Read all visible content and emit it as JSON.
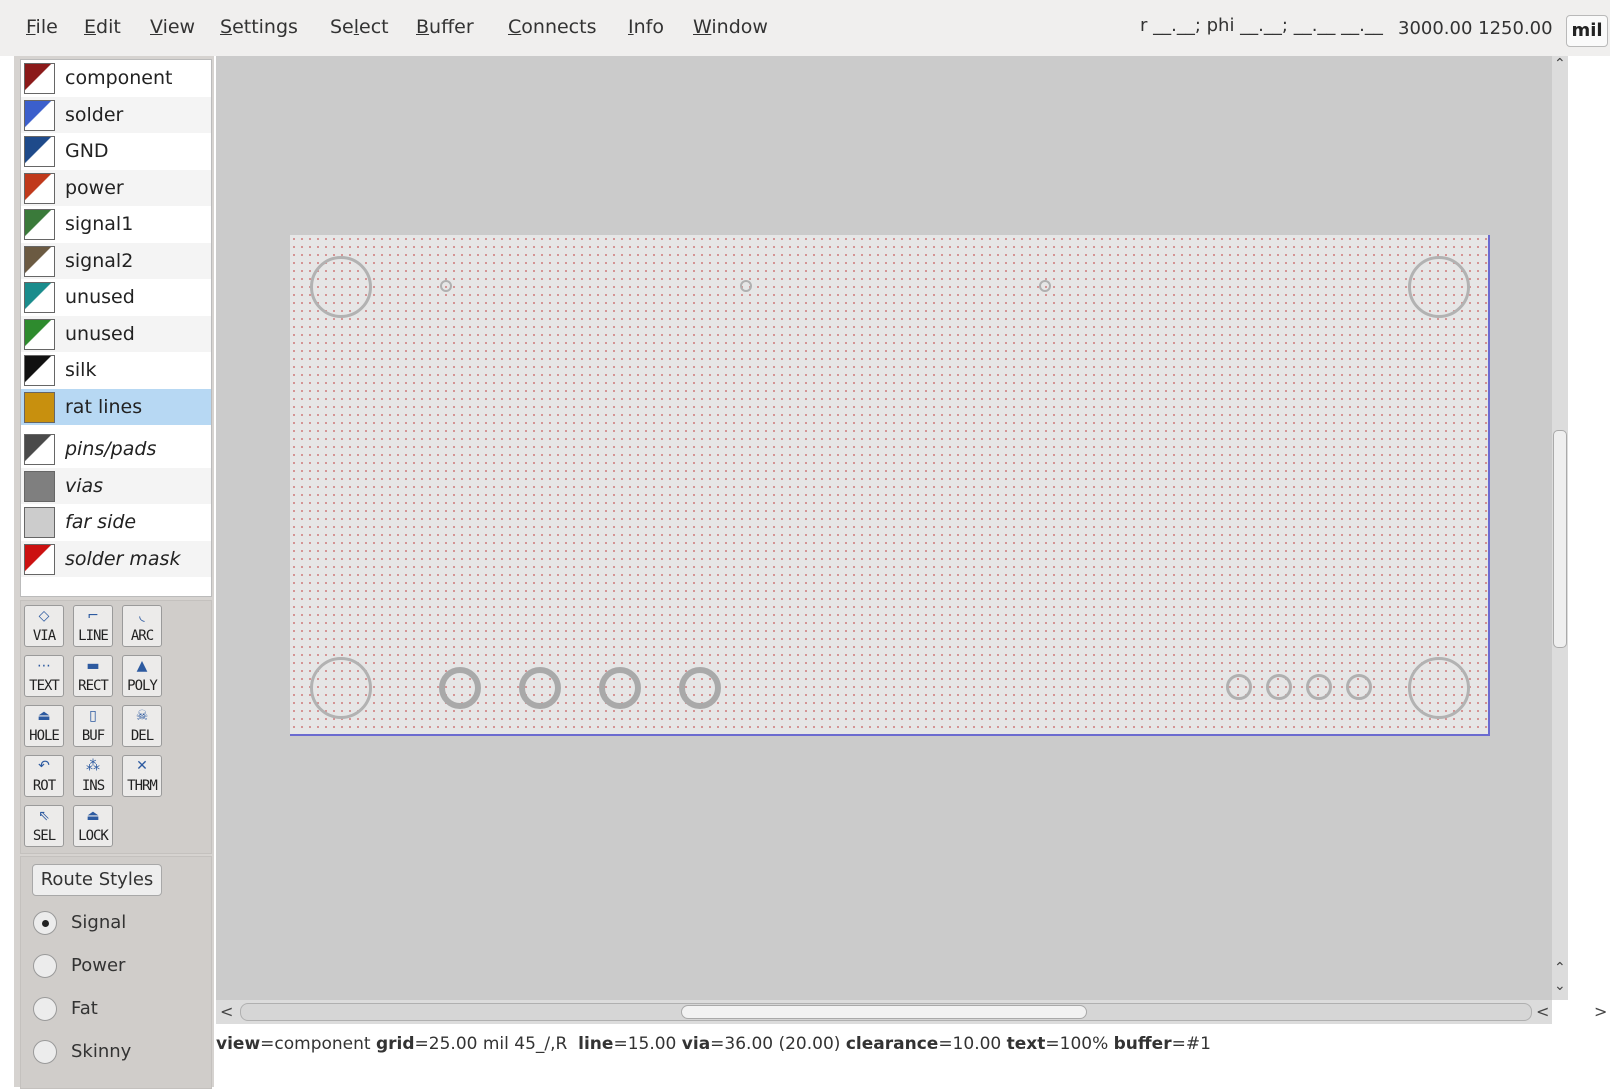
{
  "menu": {
    "items": [
      {
        "pre": "",
        "u": "F",
        "post": "ile"
      },
      {
        "pre": "",
        "u": "E",
        "post": "dit"
      },
      {
        "pre": "",
        "u": "V",
        "post": "iew"
      },
      {
        "pre": "",
        "u": "S",
        "post": "ettings"
      },
      {
        "pre": "Se",
        "u": "l",
        "post": "ect"
      },
      {
        "pre": "",
        "u": "B",
        "post": "uffer"
      },
      {
        "pre": "",
        "u": "C",
        "post": "onnects"
      },
      {
        "pre": "",
        "u": "I",
        "post": "nfo"
      },
      {
        "pre": "",
        "u": "W",
        "post": "indow"
      }
    ]
  },
  "coords": {
    "polar": "r __.__; phi __.__; __.__ __.__",
    "xy": "3000.00 1250.00",
    "unit": "mil"
  },
  "layers": [
    {
      "label": "component",
      "color": "#8b1a1a",
      "style": "normal"
    },
    {
      "label": "solder",
      "color": "#3b5fcc",
      "style": "normal"
    },
    {
      "label": "GND",
      "color": "#1e4a8a",
      "style": "normal"
    },
    {
      "label": "power",
      "color": "#c0391b",
      "style": "normal"
    },
    {
      "label": "signal1",
      "color": "#3a7a3a",
      "style": "normal"
    },
    {
      "label": "signal2",
      "color": "#6b5a42",
      "style": "normal"
    },
    {
      "label": "unused",
      "color": "#1a8c8c",
      "style": "normal"
    },
    {
      "label": "unused",
      "color": "#2e8b2e",
      "style": "normal"
    },
    {
      "label": "silk",
      "color": "#111111",
      "style": "normal"
    },
    {
      "label": "rat lines",
      "color": "#c8900e",
      "style": "selected"
    },
    {
      "label": "pins/pads",
      "color": "#4a4a4a",
      "style": "italic"
    },
    {
      "label": "vias",
      "color": "#7f7f7f",
      "style": "italic"
    },
    {
      "label": "far side",
      "color": "#cccccc",
      "style": "italic"
    },
    {
      "label": "solder mask",
      "color": "#cc1111",
      "style": "italic"
    }
  ],
  "tools": [
    {
      "label": "VIA",
      "icon": "via-icon",
      "glyph": "◇"
    },
    {
      "label": "LINE",
      "icon": "line-icon",
      "glyph": "⌐"
    },
    {
      "label": "ARC",
      "icon": "arc-icon",
      "glyph": "◟"
    },
    {
      "label": "TEXT",
      "icon": "text-icon",
      "glyph": "⋯"
    },
    {
      "label": "RECT",
      "icon": "rect-icon",
      "glyph": "▬"
    },
    {
      "label": "POLY",
      "icon": "poly-icon",
      "glyph": "▲"
    },
    {
      "label": "HOLE",
      "icon": "hole-icon",
      "glyph": "⏏"
    },
    {
      "label": "BUF",
      "icon": "buffer-icon",
      "glyph": "▯"
    },
    {
      "label": "DEL",
      "icon": "skull-icon",
      "glyph": "☠"
    },
    {
      "label": "ROT",
      "icon": "rotate-icon",
      "glyph": "↶"
    },
    {
      "label": "INS",
      "icon": "insert-icon",
      "glyph": "⁂"
    },
    {
      "label": "THRM",
      "icon": "thermal-icon",
      "glyph": "✕"
    },
    {
      "label": "SEL",
      "icon": "select-arrow-icon",
      "glyph": "⇖"
    },
    {
      "label": "LOCK",
      "icon": "lock-icon",
      "glyph": "⏏"
    }
  ],
  "route_styles": {
    "title": "Route Styles",
    "options": [
      "Signal",
      "Power",
      "Fat",
      "Skinny"
    ],
    "selected": "Signal"
  },
  "status": {
    "view_key": "view",
    "view_val": "=component ",
    "grid_key": "grid",
    "grid_val": "=25.00 mil 45_/,R  ",
    "line_key": "line",
    "line_val": "=15.00 ",
    "via_key": "via",
    "via_val": "=36.00 (20.00) ",
    "clearance_key": "clearance",
    "clearance_val": "=10.00 ",
    "text_key": "text",
    "text_val": "=100% ",
    "buffer_key": "buffer",
    "buffer_val": "=#1"
  }
}
